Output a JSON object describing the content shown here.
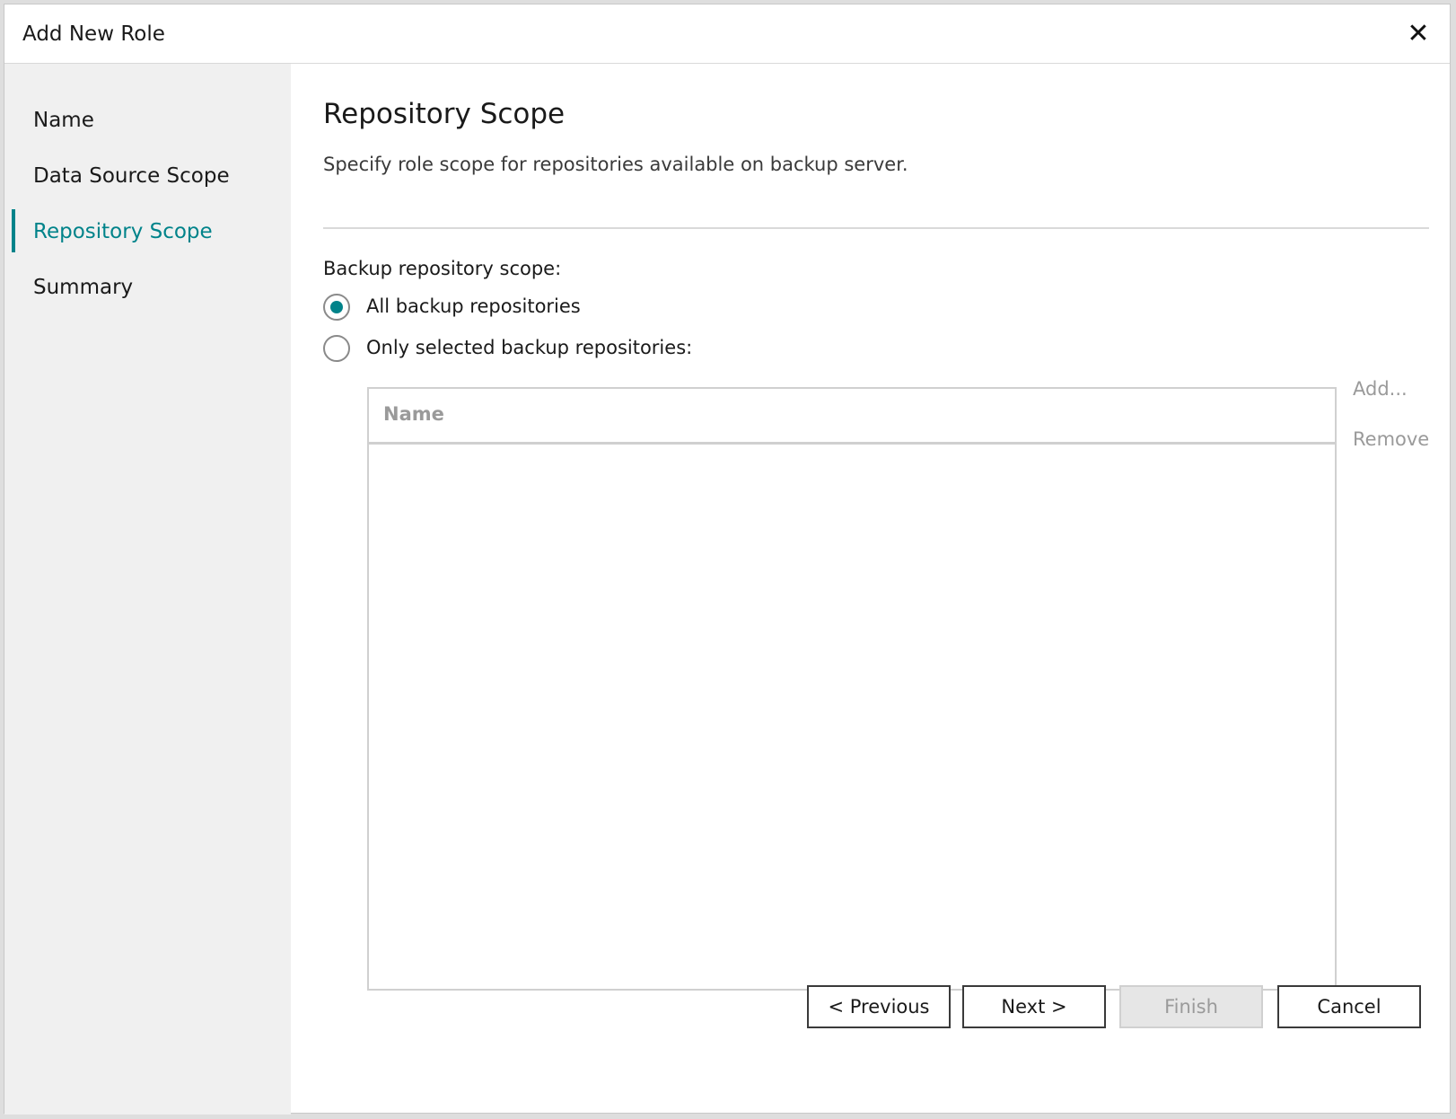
{
  "window": {
    "title": "Add New Role",
    "close_icon": "close-icon"
  },
  "sidebar": {
    "items": [
      {
        "label": "Name",
        "active": false
      },
      {
        "label": "Data Source Scope",
        "active": false
      },
      {
        "label": "Repository Scope",
        "active": true
      },
      {
        "label": "Summary",
        "active": false
      }
    ]
  },
  "main": {
    "title": "Repository Scope",
    "description": "Specify role scope for repositories available on backup server.",
    "scope_label": "Backup repository scope:",
    "options": [
      {
        "label": "All backup repositories",
        "selected": true
      },
      {
        "label": "Only selected backup repositories:",
        "selected": false
      }
    ],
    "list": {
      "column_header": "Name",
      "rows": []
    },
    "add_label": "Add...",
    "remove_label": "Remove"
  },
  "footer": {
    "previous_label": "< Previous",
    "next_label": "Next >",
    "finish_label": "Finish",
    "cancel_label": "Cancel"
  },
  "colors": {
    "accent": "#00838a",
    "sidebar_bg": "#f0f0f0",
    "disabled_text": "#9a9a9a"
  }
}
